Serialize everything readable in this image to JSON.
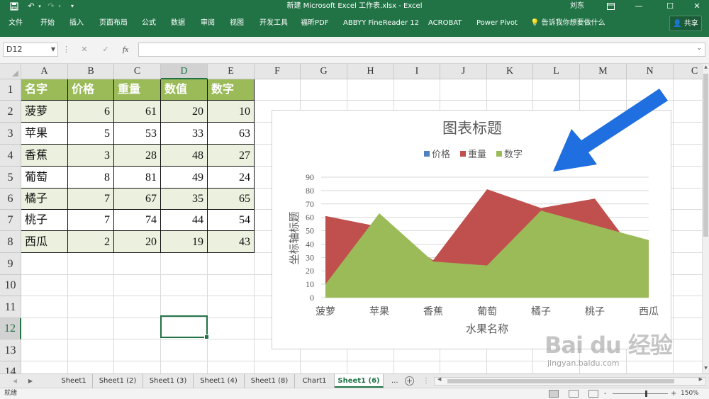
{
  "titlebar": {
    "title": "新建 Microsoft Excel 工作表.xlsx  -  Excel",
    "user": "刘东",
    "save_icon": "save-icon",
    "undo_icon": "undo-icon",
    "redo_icon": "redo-icon",
    "customize_icon": "customize-qat-icon",
    "ribbon_display_icon": "ribbon-display-options-icon",
    "minimize_icon": "minimize-icon",
    "restore_icon": "restore-icon",
    "close_icon": "close-icon"
  },
  "ribbon": {
    "tabs": [
      "文件",
      "开始",
      "插入",
      "页面布局",
      "公式",
      "数据",
      "审阅",
      "视图",
      "开发工具",
      "福昕PDF",
      "ABBYY FineReader 12",
      "ACROBAT",
      "Power Pivot"
    ],
    "tell_me": "告诉我你想要做什么",
    "share": "共享"
  },
  "formula_bar": {
    "name_box": "D12",
    "formula": ""
  },
  "grid": {
    "columns": [
      "A",
      "B",
      "C",
      "D",
      "E",
      "F",
      "G",
      "H",
      "I",
      "J",
      "K",
      "L",
      "M",
      "N",
      "C"
    ],
    "rows": [
      "1",
      "2",
      "3",
      "4",
      "5",
      "6",
      "7",
      "8",
      "9",
      "10",
      "11",
      "12",
      "13",
      "14"
    ],
    "selected_column": "D",
    "selected_row": "12"
  },
  "table": {
    "headers": [
      "名字",
      "价格",
      "重量",
      "数值",
      "数字"
    ],
    "rows": [
      [
        "菠萝",
        "6",
        "61",
        "20",
        "10"
      ],
      [
        "苹果",
        "5",
        "53",
        "33",
        "63"
      ],
      [
        "香蕉",
        "3",
        "28",
        "48",
        "27"
      ],
      [
        "葡萄",
        "8",
        "81",
        "49",
        "24"
      ],
      [
        "橘子",
        "7",
        "67",
        "35",
        "65"
      ],
      [
        "桃子",
        "7",
        "74",
        "44",
        "54"
      ],
      [
        "西瓜",
        "2",
        "20",
        "19",
        "43"
      ]
    ]
  },
  "chart_data": {
    "type": "area",
    "title": "图表标题",
    "xlabel": "水果名称",
    "ylabel": "坐标轴标题",
    "categories": [
      "菠萝",
      "苹果",
      "香蕉",
      "葡萄",
      "橘子",
      "桃子",
      "西瓜"
    ],
    "series": [
      {
        "name": "价格",
        "values": [
          6,
          5,
          3,
          8,
          7,
          7,
          2
        ],
        "color": "#4f81bd"
      },
      {
        "name": "重量",
        "values": [
          61,
          53,
          28,
          81,
          67,
          74,
          20
        ],
        "color": "#c0504d"
      },
      {
        "name": "数字",
        "values": [
          10,
          63,
          27,
          24,
          65,
          54,
          43
        ],
        "color": "#9bbb59"
      }
    ],
    "ylim": [
      0,
      90
    ],
    "yticks": [
      "0",
      "10",
      "20",
      "30",
      "40",
      "50",
      "60",
      "70",
      "80",
      "90"
    ],
    "grid": true,
    "legend": "top"
  },
  "annotation": {
    "color": "#1f6fe0",
    "icon": "arrow-annotation-icon"
  },
  "sheets": {
    "tabs": [
      "Sheet1",
      "Sheet1 (2)",
      "Sheet1 (3)",
      "Sheet1 (4)",
      "Sheet1 (8)",
      "Chart1",
      "Sheet1 (6)"
    ],
    "active": "Sheet1 (6)",
    "more": "..."
  },
  "statusbar": {
    "ready": "就绪",
    "zoom": "150%",
    "minus": "-",
    "plus": "+"
  },
  "watermark": {
    "main": "Bai du 经验",
    "sub": "jingyan.baidu.com"
  },
  "colors": {
    "accent": "#217346",
    "header_fill": "#9bbb59",
    "band_fill": "#ebf1de"
  }
}
